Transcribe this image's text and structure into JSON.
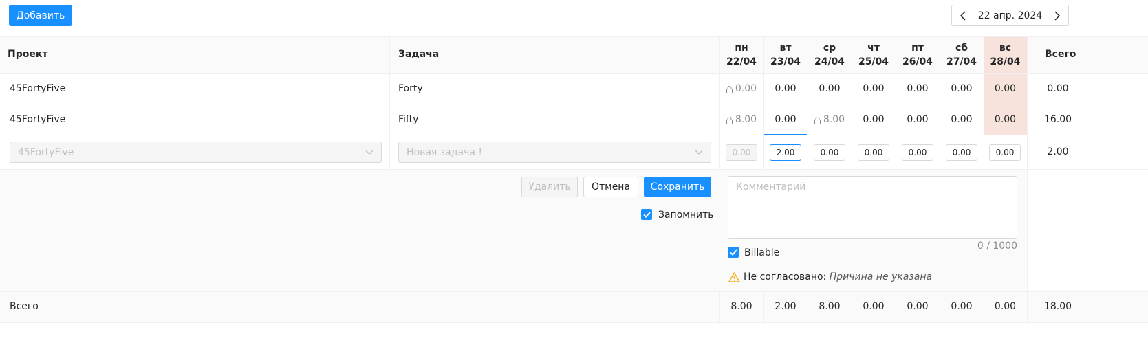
{
  "toolbar": {
    "add_label": "Добавить",
    "date_label": "22 апр. 2024"
  },
  "table": {
    "col_project": "Проект",
    "col_task": "Задача",
    "col_total": "Всего",
    "days": [
      {
        "dow": "пн",
        "date": "22/04"
      },
      {
        "dow": "вт",
        "date": "23/04"
      },
      {
        "dow": "ср",
        "date": "24/04"
      },
      {
        "dow": "чт",
        "date": "25/04"
      },
      {
        "dow": "пт",
        "date": "26/04"
      },
      {
        "dow": "сб",
        "date": "27/04"
      },
      {
        "dow": "вс",
        "date": "28/04"
      }
    ],
    "rows": [
      {
        "project": "45FortyFive",
        "task": "Forty",
        "hours": [
          "0.00",
          "0.00",
          "0.00",
          "0.00",
          "0.00",
          "0.00",
          "0.00"
        ],
        "total": "0.00"
      },
      {
        "project": "45FortyFive",
        "task": "Fifty",
        "hours": [
          "8.00",
          "0.00",
          "8.00",
          "0.00",
          "0.00",
          "0.00",
          "0.00"
        ],
        "total": "16.00"
      }
    ],
    "edit_row": {
      "project_value": "45FortyFive",
      "task_placeholder": "Новая задача !",
      "hours": [
        "0.00",
        "2.00",
        "0.00",
        "0.00",
        "0.00",
        "0.00",
        "0.00"
      ],
      "total": "2.00"
    },
    "footer": {
      "label": "Всего",
      "hours": [
        "8.00",
        "2.00",
        "8.00",
        "0.00",
        "0.00",
        "0.00",
        "0.00"
      ],
      "total": "18.00"
    }
  },
  "edit_panel": {
    "delete_label": "Удалить",
    "cancel_label": "Отмена",
    "save_label": "Сохранить",
    "remember_label": "Запомнить",
    "remember_checked": true,
    "comment_placeholder": "Комментарий",
    "comment_counter": "0 / 1000",
    "billable_label": "Billable",
    "billable_checked": true,
    "status_label": "Не согласовано:",
    "status_reason": "Причина не указана"
  },
  "colors": {
    "primary": "#1890ff",
    "weekend_bg": "#f7e3dc",
    "warning": "#faad14"
  }
}
